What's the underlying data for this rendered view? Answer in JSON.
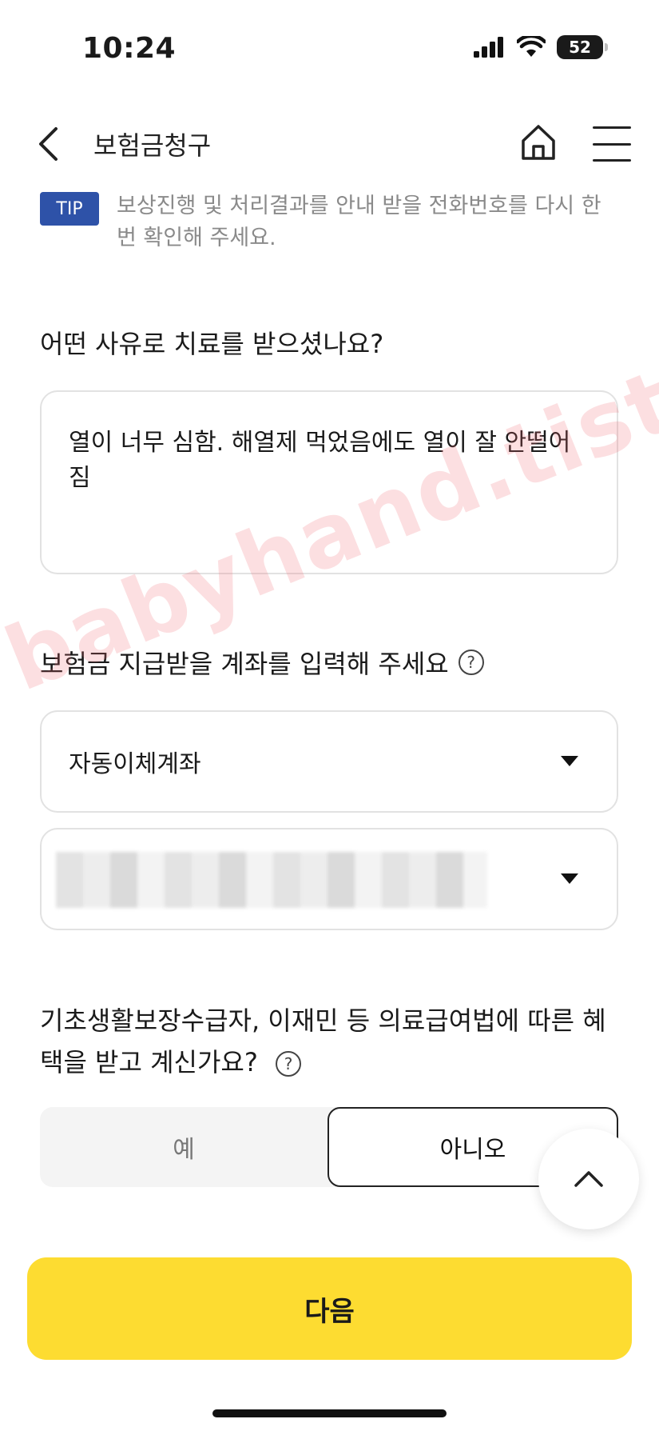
{
  "status_bar": {
    "time": "10:24",
    "battery": "52"
  },
  "header": {
    "title": "보험금청구"
  },
  "tip": {
    "badge": "TIP",
    "text": "보상진행 및 처리결과를 안내 받을 전화번호를 다시 한 번 확인해 주세요."
  },
  "reason": {
    "question": "어떤 사유로 치료를 받으셨나요?",
    "answer": "열이 너무 심함. 해열제 먹었음에도 열이 잘 안떨어짐"
  },
  "account": {
    "question": "보험금 지급받을 계좌를 입력해 주세요",
    "type_value": "자동이체계좌",
    "account_value": ""
  },
  "benefit": {
    "question": "기초생활보장수급자, 이재민 등 의료급여법에 따른 혜택을 받고 계신가요?",
    "yes_label": "예",
    "no_label": "아니오",
    "selected": "아니오"
  },
  "next_button": "다음",
  "watermark": "babyhand.tistory.com"
}
